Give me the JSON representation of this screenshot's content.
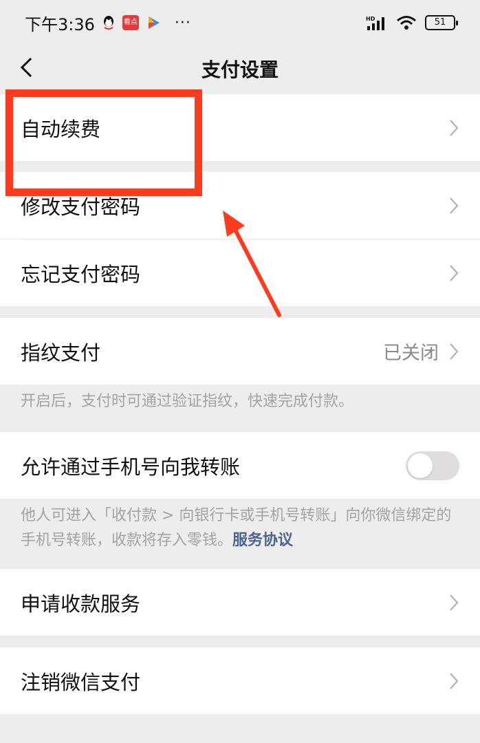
{
  "status_bar": {
    "time": "下午3:36",
    "app_icons": [
      "qq-icon",
      "kandian-icon",
      "play-icon"
    ],
    "kandian_label": "看点",
    "more": "···",
    "network": "HD",
    "battery": "51"
  },
  "nav": {
    "title": "支付设置",
    "back_icon": "chevron-left-icon"
  },
  "rows": {
    "auto_renew": {
      "label": "自动续费"
    },
    "change_password": {
      "label": "修改支付密码"
    },
    "forgot_password": {
      "label": "忘记支付密码"
    },
    "fingerprint": {
      "label": "指纹支付",
      "value": "已关闭"
    },
    "phone_transfer": {
      "label": "允许通过手机号向我转账",
      "toggle_on": false
    },
    "apply_receive": {
      "label": "申请收款服务"
    },
    "cancel_pay": {
      "label": "注销微信支付"
    }
  },
  "notes": {
    "fingerprint": "开启后，支付时可通过验证指纹，快速完成付款。",
    "phone_transfer_text": "他人可进入「收付款 > 向银行卡或手机号转账」向你微信绑定的手机号转账，收款将存入零钱。",
    "phone_transfer_link": "服务协议"
  },
  "colors": {
    "background": "#ededed",
    "highlight": "#ff3b1f",
    "link": "#4a6690"
  }
}
